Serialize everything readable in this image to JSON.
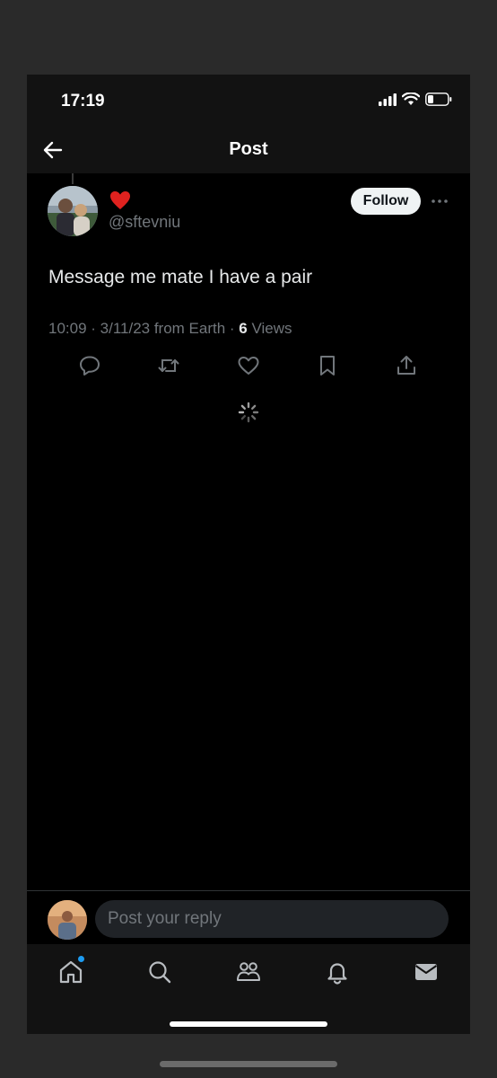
{
  "status_bar": {
    "time": "17:19"
  },
  "nav": {
    "title": "Post"
  },
  "post": {
    "display_name_emoji": "❤️",
    "handle": "@sftevniu",
    "follow_label": "Follow",
    "text": "Message me mate I have a pair",
    "meta_prefix": "10:09 · 3/11/23 from Earth · ",
    "views_count": "6",
    "views_label": " Views"
  },
  "reply": {
    "placeholder": "Post your reply"
  },
  "tabs": {
    "items": [
      "home",
      "search",
      "communities",
      "notifications",
      "messages"
    ],
    "home_has_badge": true,
    "accent_color": "#1d9bf0"
  },
  "icons": [
    "back-arrow-icon",
    "more-icon",
    "reply-icon",
    "repost-icon",
    "like-icon",
    "bookmark-icon",
    "share-icon",
    "loading-spinner-icon",
    "home-icon",
    "search-icon",
    "communities-icon",
    "notifications-icon",
    "messages-icon"
  ]
}
